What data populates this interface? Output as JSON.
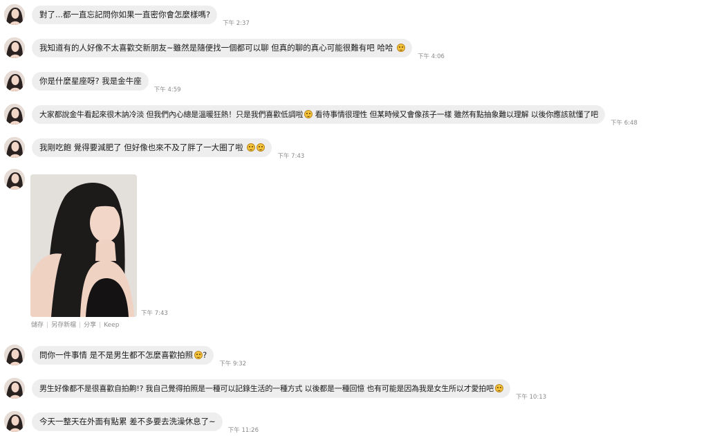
{
  "messages": [
    {
      "text": "對了...都一直忘記問你如果一直密你會怎麼樣嗎?",
      "time": "下午 2:37",
      "emoji": 0
    },
    {
      "text": "我知道有的人好像不太喜歡交新朋友~雖然是隨便找一個都可以聊 但真的聊的真心可能很難有吧 哈哈",
      "time": "下午 4:06",
      "emoji": 1
    },
    {
      "text": "你是什麼星座呀? 我是金牛座",
      "time": "下午 4:59",
      "emoji": 0
    },
    {
      "text_a": "大家都說金牛看起來很木訥冷淡 但我們內心總是溫暖狂熱！只是我們喜歡低調啦",
      "text_b": " 看待事情很理性 但某時候又會像孩子一樣 雖然有點抽象難以理解 以後你應該就懂了吧",
      "time": "下午 6:48"
    },
    {
      "text": "我剛吃飽 覺得要減肥了 但好像也來不及了胖了一大圈了啦 ",
      "time": "下午 7:43",
      "emoji": 2
    },
    {
      "photo_time": "下午 7:43",
      "actions": [
        "儲存",
        "另存新檔",
        "分享",
        "Keep"
      ]
    },
    {
      "text_a": "問你一件事情 是不是男生都不怎麼喜歡拍照",
      "text_b": "?",
      "time": "下午 9:32"
    },
    {
      "text": "男生好像都不是很喜歡自拍齁!? 我自己覺得拍照是一種可以記錄生活的一種方式 以後都是一種回憶 也有可能是因為我是女生所以才愛拍吧",
      "time": "下午 10:13",
      "emoji": 1
    },
    {
      "text": "今天一整天在外面有點累 差不多要去洗澡休息了~",
      "time": "下午 11:26",
      "emoji": 0
    }
  ],
  "colors": {
    "bubble": "#eeeeee",
    "time": "#888888",
    "emoji": "#f5c33b"
  },
  "icons": {
    "emoji": "grinning-face-emoji-icon",
    "avatar": "user-avatar"
  }
}
